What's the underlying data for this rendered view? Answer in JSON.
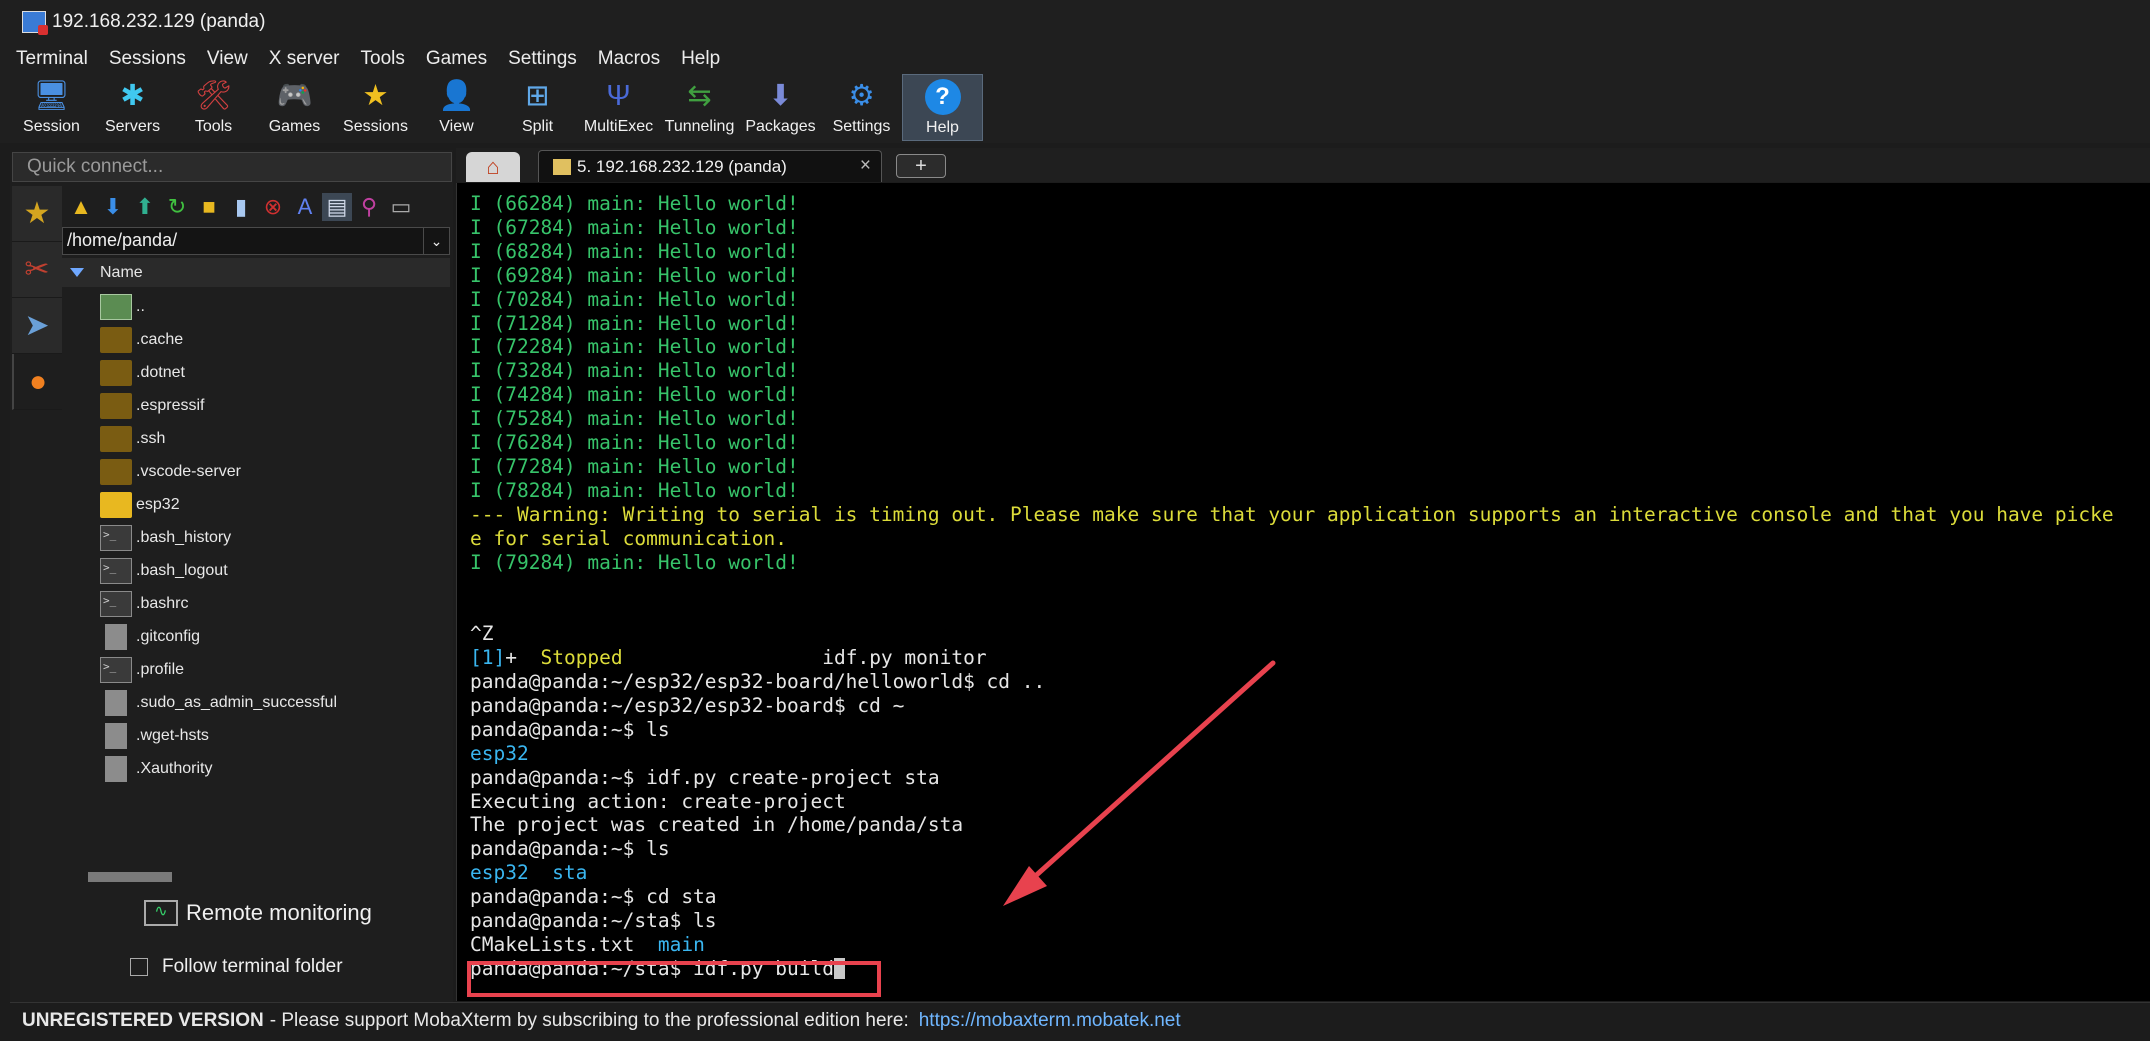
{
  "window": {
    "title": "192.168.232.129 (panda)"
  },
  "menu": [
    "Terminal",
    "Sessions",
    "View",
    "X server",
    "Tools",
    "Games",
    "Settings",
    "Macros",
    "Help"
  ],
  "toolbar": [
    {
      "label": "Session",
      "icon": "session-icon",
      "glyph": "🖥"
    },
    {
      "label": "Servers",
      "icon": "servers-icon",
      "glyph": "✱"
    },
    {
      "label": "Tools",
      "icon": "tools-icon",
      "glyph": "🛠"
    },
    {
      "label": "Games",
      "icon": "games-icon",
      "glyph": "🎮"
    },
    {
      "label": "Sessions",
      "icon": "sessions-star-icon",
      "glyph": "★"
    },
    {
      "label": "View",
      "icon": "view-icon",
      "glyph": "👤"
    },
    {
      "label": "Split",
      "icon": "split-icon",
      "glyph": "⊞"
    },
    {
      "label": "MultiExec",
      "icon": "multiexec-icon",
      "glyph": "Ψ"
    },
    {
      "label": "Tunneling",
      "icon": "tunneling-icon",
      "glyph": "⇆"
    },
    {
      "label": "Packages",
      "icon": "packages-icon",
      "glyph": "⬇"
    },
    {
      "label": "Settings",
      "icon": "settings-icon",
      "glyph": "⚙"
    },
    {
      "label": "Help",
      "icon": "help-icon",
      "glyph": "?"
    }
  ],
  "quick_connect": {
    "placeholder": "Quick connect..."
  },
  "sidebar": {
    "path": "/home/panda/",
    "column_header": "Name",
    "files": [
      {
        "name": "..",
        "type": "up"
      },
      {
        "name": ".cache",
        "type": "folder"
      },
      {
        "name": ".dotnet",
        "type": "folder"
      },
      {
        "name": ".espressif",
        "type": "folder"
      },
      {
        "name": ".ssh",
        "type": "folder"
      },
      {
        "name": ".vscode-server",
        "type": "folder"
      },
      {
        "name": "esp32",
        "type": "folder-bright"
      },
      {
        "name": ".bash_history",
        "type": "term"
      },
      {
        "name": ".bash_logout",
        "type": "term"
      },
      {
        "name": ".bashrc",
        "type": "term"
      },
      {
        "name": ".gitconfig",
        "type": "doc"
      },
      {
        "name": ".profile",
        "type": "term"
      },
      {
        "name": ".sudo_as_admin_successful",
        "type": "doc"
      },
      {
        "name": ".wget-hsts",
        "type": "doc"
      },
      {
        "name": ".Xauthority",
        "type": "doc"
      }
    ],
    "remote_monitoring": "Remote monitoring",
    "follow_terminal_folder": "Follow terminal folder",
    "follow_checked": false
  },
  "tabs": {
    "session_tab": "5. 192.168.232.129 (panda)",
    "close": "×",
    "new_tab": "+"
  },
  "terminal": {
    "lines": [
      {
        "text": "I (66284) main: Hello world!",
        "color": "green"
      },
      {
        "text": "I (67284) main: Hello world!",
        "color": "green"
      },
      {
        "text": "I (68284) main: Hello world!",
        "color": "green"
      },
      {
        "text": "I (69284) main: Hello world!",
        "color": "green"
      },
      {
        "text": "I (70284) main: Hello world!",
        "color": "green"
      },
      {
        "text": "I (71284) main: Hello world!",
        "color": "green"
      },
      {
        "text": "I (72284) main: Hello world!",
        "color": "green"
      },
      {
        "text": "I (73284) main: Hello world!",
        "color": "green"
      },
      {
        "text": "I (74284) main: Hello world!",
        "color": "green"
      },
      {
        "text": "I (75284) main: Hello world!",
        "color": "green"
      },
      {
        "text": "I (76284) main: Hello world!",
        "color": "green"
      },
      {
        "text": "I (77284) main: Hello world!",
        "color": "green"
      },
      {
        "text": "I (78284) main: Hello world!",
        "color": "green"
      },
      {
        "text": "--- Warning: Writing to serial is timing out. Please make sure that your application supports an interactive console and that you have picke",
        "color": "yellow"
      },
      {
        "text": "e for serial communication.",
        "color": "yellow"
      },
      {
        "text": "I (79284) main: Hello world!",
        "color": "green"
      },
      {
        "text": "",
        "color": "white"
      },
      {
        "text": "",
        "color": "white"
      },
      {
        "text": "^Z",
        "color": "white"
      },
      {
        "segments": [
          {
            "t": "[1]",
            "c": "blue"
          },
          {
            "t": "+  ",
            "c": "white"
          },
          {
            "t": "Stopped",
            "c": "yellow"
          },
          {
            "t": "                 idf.py monitor",
            "c": "white"
          }
        ]
      },
      {
        "text": "panda@panda:~/esp32/esp32-board/helloworld$ cd ..",
        "color": "white"
      },
      {
        "text": "panda@panda:~/esp32/esp32-board$ cd ~",
        "color": "white"
      },
      {
        "text": "panda@panda:~$ ls",
        "color": "white"
      },
      {
        "text": "esp32",
        "color": "blue"
      },
      {
        "text": "panda@panda:~$ idf.py create-project sta",
        "color": "white"
      },
      {
        "text": "Executing action: create-project",
        "color": "white"
      },
      {
        "text": "The project was created in /home/panda/sta",
        "color": "white"
      },
      {
        "text": "panda@panda:~$ ls",
        "color": "white"
      },
      {
        "text": "esp32  sta",
        "color": "blue"
      },
      {
        "text": "panda@panda:~$ cd sta",
        "color": "white"
      },
      {
        "text": "panda@panda:~/sta$ ls",
        "color": "white"
      },
      {
        "segments": [
          {
            "t": "CMakeLists.txt  ",
            "c": "white"
          },
          {
            "t": "main",
            "c": "blue"
          }
        ]
      },
      {
        "text": "panda@panda:~/sta$ idf.py build",
        "color": "white",
        "cursor": true
      }
    ]
  },
  "status": {
    "unregistered": "UNREGISTERED VERSION",
    "message": "-  Please support MobaXterm by subscribing to the professional edition here:",
    "link": "https://mobaxterm.mobatek.net"
  },
  "colors": {
    "terminal_green": "#37c46a",
    "terminal_yellow": "#dcdc3a",
    "terminal_blue": "#3ab6f0",
    "annotation_red": "#e8424e"
  }
}
